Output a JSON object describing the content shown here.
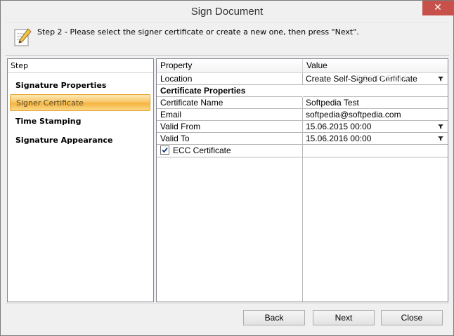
{
  "window": {
    "title": "Sign Document",
    "close_glyph": "✕"
  },
  "header": {
    "icon": "document-pencil-icon",
    "text": "Step 2 - Please select the signer certificate or create a new one, then press \"Next\"."
  },
  "steps": {
    "header": "Step",
    "items": [
      {
        "label": "Signature Properties",
        "selected": false
      },
      {
        "label": "Signer Certificate",
        "selected": true
      },
      {
        "label": "Time Stamping",
        "selected": false
      },
      {
        "label": "Signature Appearance",
        "selected": false
      }
    ]
  },
  "grid": {
    "columns": [
      "Property",
      "Value"
    ],
    "rows": [
      {
        "property": "Location",
        "value": "Create Self-Signed Certificate",
        "dropdown": true
      },
      {
        "property": "Certificate Properties",
        "group": true
      },
      {
        "property": "Certificate Name",
        "value": "Softpedia Test"
      },
      {
        "property": "Email",
        "value": "softpedia@softpedia.com"
      },
      {
        "property": "Valid From",
        "value": "15.06.2015 00:00",
        "dropdown": true
      },
      {
        "property": "Valid To",
        "value": "15.06.2016 00:00",
        "dropdown": true
      }
    ],
    "checkbox": {
      "label": "ECC Certificate",
      "checked": true
    }
  },
  "watermark": "SOFTPEDIA",
  "buttons": {
    "back": "Back",
    "next": "Next",
    "close": "Close"
  },
  "colors": {
    "selected_step": "#f7c768",
    "close_button": "#c7504b"
  }
}
